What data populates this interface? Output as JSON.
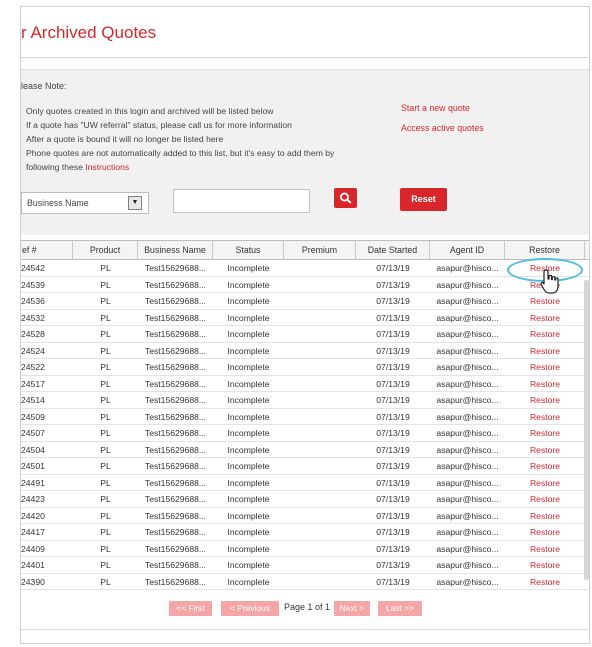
{
  "page": {
    "title": "r Archived Quotes"
  },
  "note": {
    "heading": "lease Note:",
    "lines": [
      "Only quotes created in this login and archived will be listed below",
      "If a quote has \"UW referral\" status, please call us for more information",
      "After a quote is bound it will no longer be listed here",
      "Phone quotes are not automatically added to this list, but it's easy to add them by"
    ],
    "last_line_prefix": "following these ",
    "instructions_link": "Instructions"
  },
  "side_links": {
    "start_new": "Start a new quote",
    "access_active": "Access active quotes"
  },
  "search": {
    "field_selected": "Business Name",
    "query_value": "",
    "search_icon": "magnifier-icon",
    "reset_label": "Reset"
  },
  "table": {
    "headers": [
      "ef #",
      "Product",
      "Business Name",
      "Status",
      "Premium",
      "Date Started",
      "Agent ID",
      "Restore"
    ],
    "rows": [
      {
        "ref": "24542",
        "product": "PL",
        "business": "Test15629688...",
        "status": "Incomplete",
        "premium": "",
        "date": "07/13/19",
        "agent": "asapur@hisco...",
        "restore": "Restore"
      },
      {
        "ref": "24539",
        "product": "PL",
        "business": "Test15629688...",
        "status": "Incomplete",
        "premium": "",
        "date": "07/13/19",
        "agent": "asapur@hisco...",
        "restore": "Restore"
      },
      {
        "ref": "24536",
        "product": "PL",
        "business": "Test15629688...",
        "status": "Incomplete",
        "premium": "",
        "date": "07/13/19",
        "agent": "asapur@hisco...",
        "restore": "Restore"
      },
      {
        "ref": "24532",
        "product": "PL",
        "business": "Test15629688...",
        "status": "Incomplete",
        "premium": "",
        "date": "07/13/19",
        "agent": "asapur@hisco...",
        "restore": "Restore"
      },
      {
        "ref": "24528",
        "product": "PL",
        "business": "Test15629688...",
        "status": "Incomplete",
        "premium": "",
        "date": "07/13/19",
        "agent": "asapur@hisco...",
        "restore": "Restore"
      },
      {
        "ref": "24524",
        "product": "PL",
        "business": "Test15629688...",
        "status": "Incomplete",
        "premium": "",
        "date": "07/13/19",
        "agent": "asapur@hisco...",
        "restore": "Restore"
      },
      {
        "ref": "24522",
        "product": "PL",
        "business": "Test15629688...",
        "status": "Incomplete",
        "premium": "",
        "date": "07/13/19",
        "agent": "asapur@hisco...",
        "restore": "Restore"
      },
      {
        "ref": "24517",
        "product": "PL",
        "business": "Test15629688...",
        "status": "Incomplete",
        "premium": "",
        "date": "07/13/19",
        "agent": "asapur@hisco...",
        "restore": "Restore"
      },
      {
        "ref": "24514",
        "product": "PL",
        "business": "Test15629688...",
        "status": "Incomplete",
        "premium": "",
        "date": "07/13/19",
        "agent": "asapur@hisco...",
        "restore": "Restore"
      },
      {
        "ref": "24509",
        "product": "PL",
        "business": "Test15629688...",
        "status": "Incomplete",
        "premium": "",
        "date": "07/13/19",
        "agent": "asapur@hisco...",
        "restore": "Restore"
      },
      {
        "ref": "24507",
        "product": "PL",
        "business": "Test15629688...",
        "status": "Incomplete",
        "premium": "",
        "date": "07/13/19",
        "agent": "asapur@hisco...",
        "restore": "Restore"
      },
      {
        "ref": "24504",
        "product": "PL",
        "business": "Test15629688...",
        "status": "Incomplete",
        "premium": "",
        "date": "07/13/19",
        "agent": "asapur@hisco...",
        "restore": "Restore"
      },
      {
        "ref": "24501",
        "product": "PL",
        "business": "Test15629688...",
        "status": "Incomplete",
        "premium": "",
        "date": "07/13/19",
        "agent": "asapur@hisco...",
        "restore": "Restore"
      },
      {
        "ref": "24491",
        "product": "PL",
        "business": "Test15629688...",
        "status": "Incomplete",
        "premium": "",
        "date": "07/13/19",
        "agent": "asapur@hisco...",
        "restore": "Restore"
      },
      {
        "ref": "24423",
        "product": "PL",
        "business": "Test15629688...",
        "status": "Incomplete",
        "premium": "",
        "date": "07/13/19",
        "agent": "asapur@hisco...",
        "restore": "Restore"
      },
      {
        "ref": "24420",
        "product": "PL",
        "business": "Test15629688...",
        "status": "Incomplete",
        "premium": "",
        "date": "07/13/19",
        "agent": "asapur@hisco...",
        "restore": "Restore"
      },
      {
        "ref": "24417",
        "product": "PL",
        "business": "Test15629688...",
        "status": "Incomplete",
        "premium": "",
        "date": "07/13/19",
        "agent": "asapur@hisco...",
        "restore": "Restore"
      },
      {
        "ref": "24409",
        "product": "PL",
        "business": "Test15629688...",
        "status": "Incomplete",
        "premium": "",
        "date": "07/13/19",
        "agent": "asapur@hisco...",
        "restore": "Restore"
      },
      {
        "ref": "24401",
        "product": "PL",
        "business": "Test15629688...",
        "status": "Incomplete",
        "premium": "",
        "date": "07/13/19",
        "agent": "asapur@hisco...",
        "restore": "Restore"
      },
      {
        "ref": "24390",
        "product": "PL",
        "business": "Test15629688...",
        "status": "Incomplete",
        "premium": "",
        "date": "07/13/19",
        "agent": "asapur@hisco...",
        "restore": "Restore"
      }
    ]
  },
  "pager": {
    "first": "<< First",
    "previous": "< Previous",
    "page_text": "Page 1 of 1",
    "next": "Next >",
    "last": "Last >>"
  },
  "colors": {
    "brand_red": "#d9262b",
    "highlight_ring": "#4bbde0",
    "disabled_pager": "#f4a6a6"
  }
}
